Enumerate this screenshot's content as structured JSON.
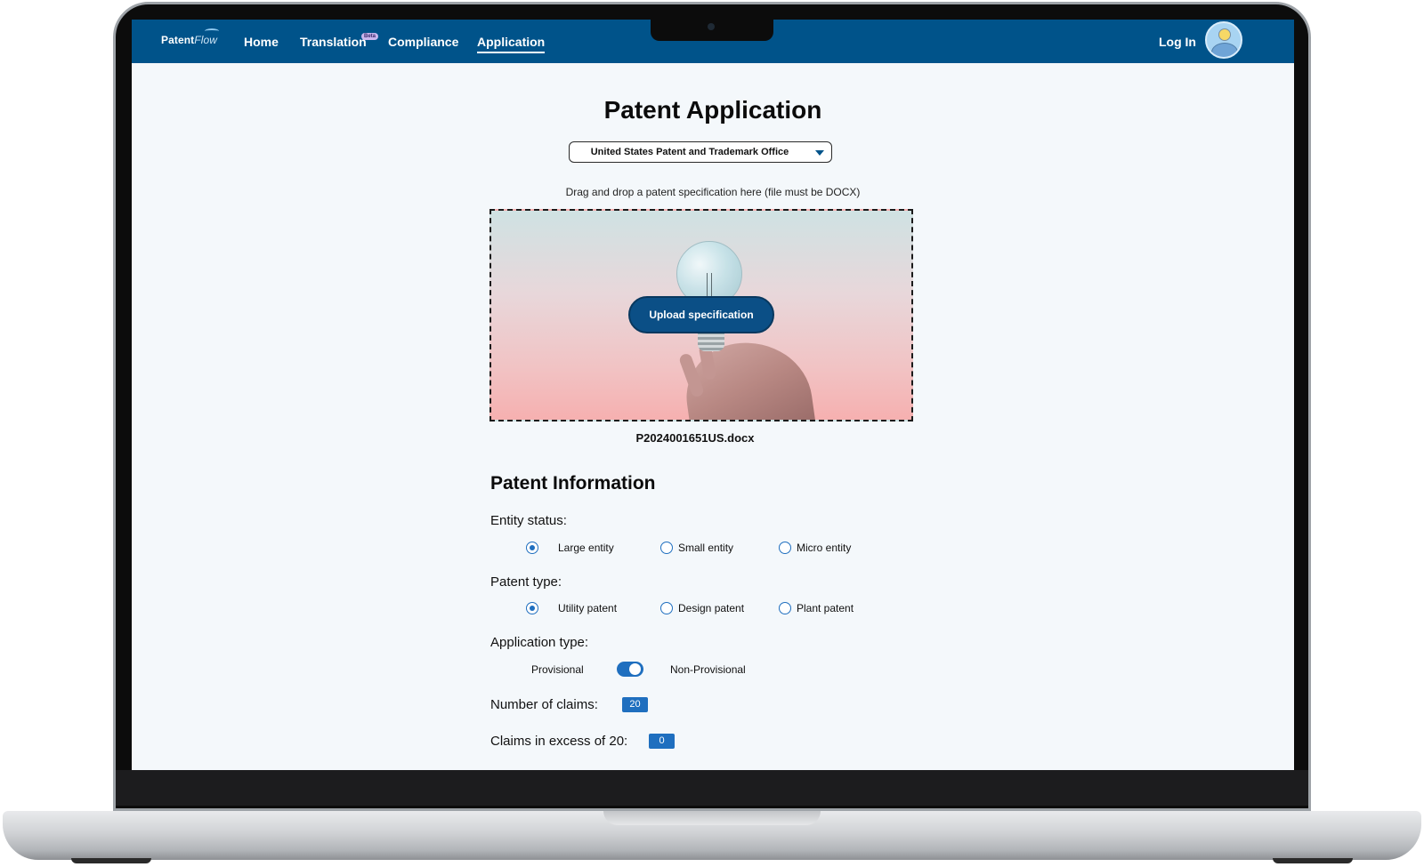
{
  "nav": {
    "logo_main": "Patent",
    "logo_accent": "Flow",
    "links": [
      "Home",
      "Translation",
      "Compliance",
      "Application"
    ],
    "active": "Application",
    "beta_badge": "Beta",
    "login": "Log In"
  },
  "page": {
    "title": "Patent Application",
    "office_selected": "United States Patent and Trademark Office",
    "drop_hint": "Drag and drop a patent specification here (file must be DOCX)",
    "upload_button": "Upload specification",
    "file_name": "P2024001651US.docx"
  },
  "patent_info": {
    "section_title": "Patent Information",
    "entity_status": {
      "label": "Entity status:",
      "options": [
        "Large entity",
        "Small entity",
        "Micro entity"
      ],
      "selected": "Large entity"
    },
    "patent_type": {
      "label": "Patent type:",
      "options": [
        "Utility patent",
        "Design patent",
        "Plant patent"
      ],
      "selected": "Utility patent"
    },
    "application_type": {
      "label": "Application type:",
      "left": "Provisional",
      "right": "Non-Provisional",
      "toggle_on": true
    },
    "claims": {
      "label": "Number of claims:",
      "value": "20"
    },
    "excess_claims": {
      "label": "Claims in excess of 20:",
      "value": "0"
    }
  },
  "colors": {
    "nav_bg": "#00538a",
    "accent": "#1f6fbf",
    "button": "#0b4f86",
    "page_bg": "#f4f8fb"
  }
}
